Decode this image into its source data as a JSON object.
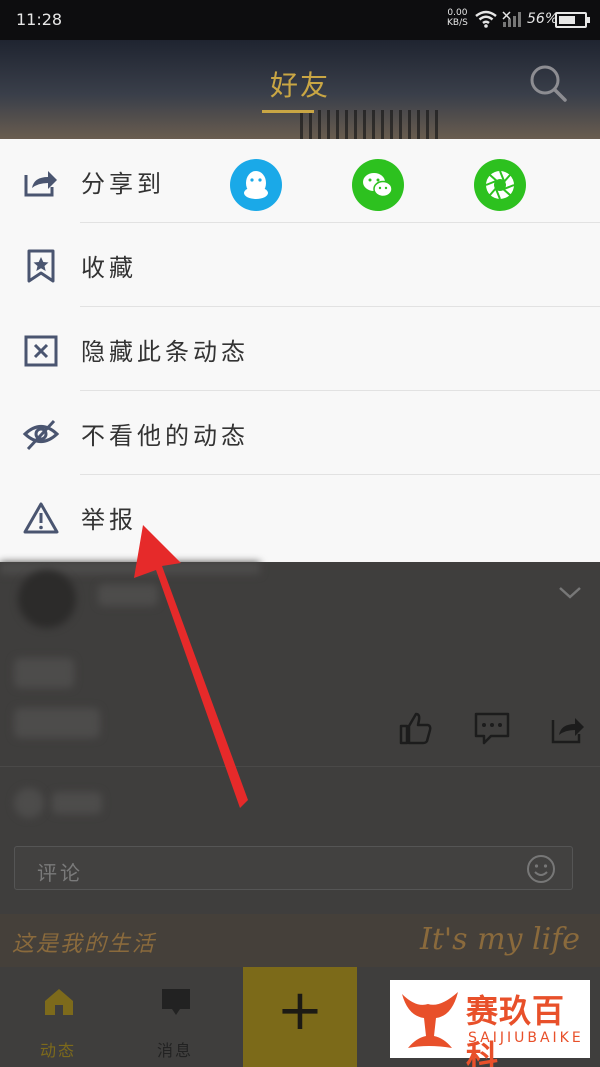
{
  "status_bar": {
    "time": "11:28",
    "net_speed": "0.00",
    "net_unit": "KB/S",
    "battery": "56%"
  },
  "header": {
    "title": "好友"
  },
  "menu": {
    "share_label": "分享到",
    "share_targets": [
      "qq",
      "wechat",
      "moments"
    ],
    "items": [
      {
        "label": "收藏",
        "icon": "bookmark-star-icon"
      },
      {
        "label": "隐藏此条动态",
        "icon": "close-box-icon"
      },
      {
        "label": "不看他的动态",
        "icon": "eye-off-icon"
      },
      {
        "label": "举报",
        "icon": "warning-icon"
      }
    ]
  },
  "feed": {
    "comment_placeholder": "评论",
    "banner_left": "这是我的生活",
    "banner_right": "It's my life"
  },
  "tabbar": {
    "tabs": [
      {
        "label": "动态",
        "active": true
      },
      {
        "label": "消息",
        "active": false
      }
    ],
    "plus": "+"
  },
  "watermark": {
    "name": "赛玖百科",
    "sub": "SAIJIUBAIKE"
  },
  "colors": {
    "accent": "#c9a644",
    "qq": "#1aa9e8",
    "wechat": "#2dc11f",
    "annotation": "#e62a2a"
  }
}
